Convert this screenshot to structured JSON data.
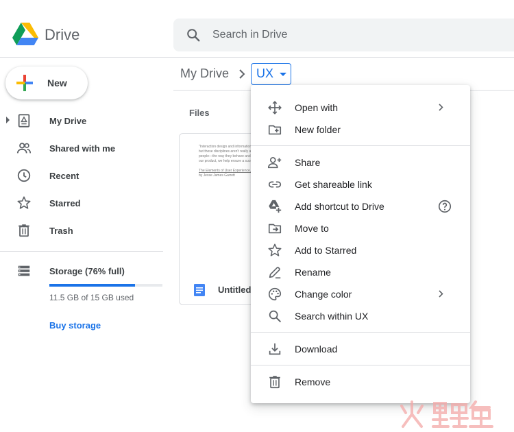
{
  "header": {
    "app_name": "Drive",
    "logo_icon": "google-drive-logo",
    "search_placeholder": "Search in Drive",
    "search_icon": "search-icon"
  },
  "sidebar": {
    "new_label": "New",
    "items": [
      {
        "label": "My Drive",
        "icon": "my-drive-icon"
      },
      {
        "label": "Shared with me",
        "icon": "people-icon"
      },
      {
        "label": "Recent",
        "icon": "clock-icon"
      },
      {
        "label": "Starred",
        "icon": "star-icon"
      },
      {
        "label": "Trash",
        "icon": "trash-icon"
      }
    ],
    "storage": {
      "title": "Storage (76% full)",
      "used_text": "11.5 GB of 15 GB used",
      "fraction": 0.76,
      "buy_label": "Buy storage"
    }
  },
  "main": {
    "breadcrumb_root": "My Drive",
    "breadcrumb_current": "UX",
    "files_label": "Files",
    "file": {
      "name": "Untitled",
      "preview_lines": [
        "\"Interaction design and information a",
        "but these disciplines aren't really ab",
        "people—the way they behave and th",
        "our product, we help ensure a succ",
        "",
        "The Elements of User Experience, Second",
        "by Jesse James Garrett"
      ]
    }
  },
  "context_menu": {
    "groups": [
      [
        {
          "label": "Open with",
          "icon": "move-arrows-icon",
          "submenu": true
        },
        {
          "label": "New folder",
          "icon": "new-folder-icon"
        }
      ],
      [
        {
          "label": "Share",
          "icon": "person-add-icon"
        },
        {
          "label": "Get shareable link",
          "icon": "link-icon"
        },
        {
          "label": "Add shortcut to Drive",
          "icon": "drive-shortcut-icon",
          "help": true
        },
        {
          "label": "Move to",
          "icon": "move-to-folder-icon"
        },
        {
          "label": "Add to Starred",
          "icon": "star-icon"
        },
        {
          "label": "Rename",
          "icon": "pencil-icon"
        },
        {
          "label": "Change color",
          "icon": "palette-icon",
          "submenu": true
        },
        {
          "label": "Search within UX",
          "icon": "search-icon"
        }
      ],
      [
        {
          "label": "Download",
          "icon": "download-icon"
        }
      ],
      [
        {
          "label": "Remove",
          "icon": "trash-icon"
        }
      ]
    ]
  },
  "colors": {
    "accent": "#1a73e8",
    "text": "#3c4043",
    "icon": "#5f6368",
    "divider": "#dadce0"
  }
}
